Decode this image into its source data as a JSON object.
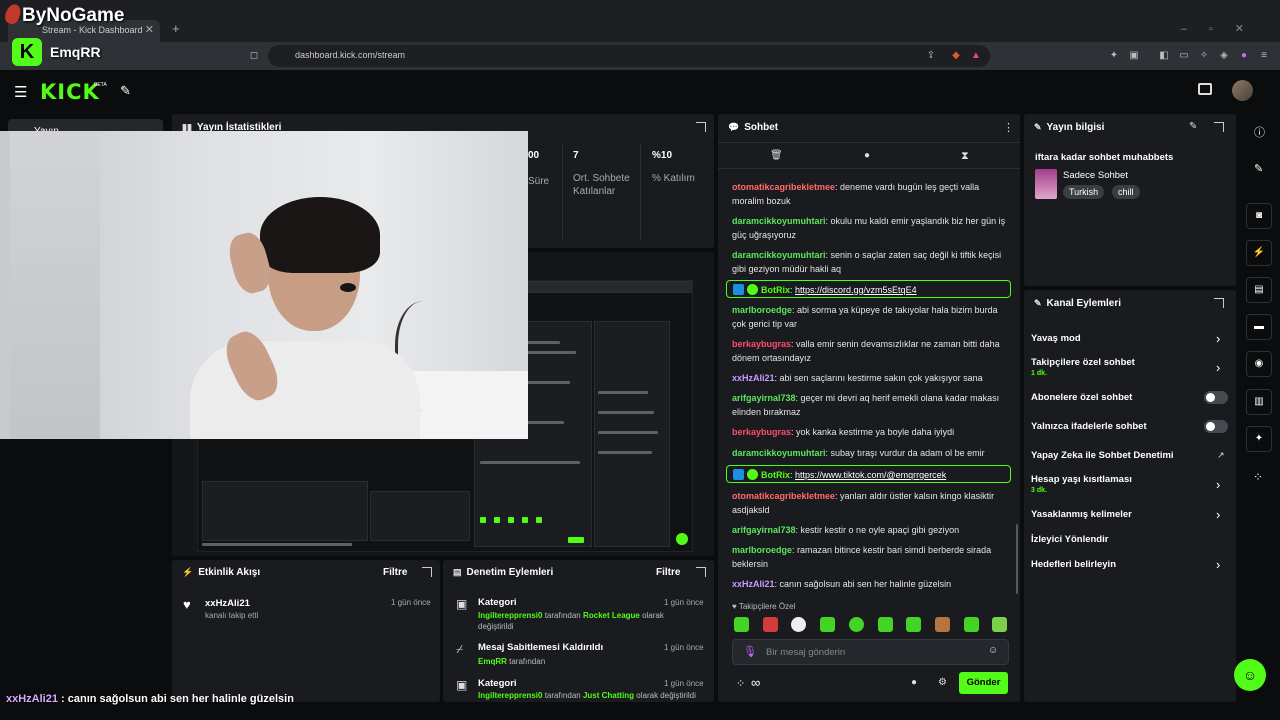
{
  "browser": {
    "tab_title": "Stream - Kick Dashboard",
    "url": "dashboard.kick.com/stream"
  },
  "overlay": {
    "brand": "ByNoGame",
    "streamer_name": "EmqRR",
    "ticker_user": "xxHzAli21",
    "ticker_message": " : canın sağolsun abi sen her halinle güzelsin"
  },
  "header": {
    "logo": "KICK",
    "beta": "BETA"
  },
  "sidebar": {
    "item_label": "Yayın"
  },
  "stats": {
    "title": "Yayın İstatistikleri",
    "columns": [
      {
        "value": "00",
        "label": "Süre"
      },
      {
        "value": "7",
        "label": "Ort. Sohbete Katılanlar"
      },
      {
        "value": "%10",
        "label": "% Katılım"
      }
    ]
  },
  "activity": {
    "title": "Etkinlik Akışı",
    "filter": "Filtre",
    "items": [
      {
        "user": "xxHzAli21",
        "desc": "kanalı takip etti",
        "time": "1 gün önce"
      }
    ]
  },
  "moderation": {
    "title": "Denetim Eylemleri",
    "filter": "Filtre",
    "items": [
      {
        "title": "Kategori",
        "actor": "Ingilterepprensi0",
        "mid": " tarafından ",
        "target": "Rocket League",
        "tail": " olarak değiştirildi",
        "time": "1 gün önce"
      },
      {
        "title": "Mesaj Sabitlemesi Kaldırıldı",
        "actor": "EmqRR",
        "mid": " tarafından",
        "target": "",
        "tail": "",
        "time": "1 gün önce"
      },
      {
        "title": "Kategori",
        "actor": "Ingilterepprensi0",
        "mid": " tarafından ",
        "target": "Just Chatting",
        "tail": " olarak değiştirildi",
        "time": "1 gün önce"
      }
    ]
  },
  "chat": {
    "title": "Sohbet",
    "messages": [
      {
        "user": "otomatikcagribekletmee",
        "color": "#ff6b6b",
        "text": ": deneme vardı bugün leş geçti valla moralim bozuk"
      },
      {
        "user": "daramcikkoyumuhtari",
        "color": "#5ce65c",
        "text": ": okulu mu kaldı emir yaşlandık biz her gün iş güç uğraşıyoruz"
      },
      {
        "user": "daramcikkoyumuhtari",
        "color": "#5ce65c",
        "text": ": senin o saçlar zaten saç değil ki tiftik keçisi gibi geziyon müdür hakli aq"
      },
      {
        "user": "marlboroedge",
        "color": "#5ce65c",
        "text": ": abi sorma ya küpeye de takıyolar hala bizim burda çok gerici tip var"
      },
      {
        "user": "berkaybugras",
        "color": "#ff4d6d",
        "text": ": valla emir senin devamsızlıklar ne zaman bitti daha dönem ortasındayız"
      },
      {
        "user": "xxHzAli21",
        "color": "#c89bff",
        "text": ": abi sen saçlarını kestirme sakın çok yakışıyor sana"
      },
      {
        "user": "arifgayirnal738",
        "color": "#5ce65c",
        "text": ": geçer mi devri aq herif emekli olana kadar makası elinden bırakmaz"
      },
      {
        "user": "berkaybugras",
        "color": "#ff4d6d",
        "text": ": yok kanka kestirme ya boyle daha iyiydi"
      },
      {
        "user": "daramcikkoyumuhtari",
        "color": "#5ce65c",
        "text": ": subay tıraşı vurdur da adam ol be emir"
      },
      {
        "user": "otomatikcagribekletmee",
        "color": "#ff6b6b",
        "text": ": yanları aldır üstler kalsın kingo klasiktir asdjaksld"
      },
      {
        "user": "arifgayirnal738",
        "color": "#5ce65c",
        "text": ": kestir kestir o ne oyle apaçi gibi geziyon"
      },
      {
        "user": "marlboroedge",
        "color": "#5ce65c",
        "text": ": ramazan bitince kestir bari simdi berberde sirada beklersin"
      },
      {
        "user": "xxHzAli21",
        "color": "#c89bff",
        "text": ": canın sağolsun abi sen her halinle güzelsin"
      }
    ],
    "bot_messages": [
      {
        "name": "BotRix",
        "link": "https://discord.gg/vzm5sEtqE4"
      },
      {
        "name": "BotRix",
        "link": "https://www.tiktok.com/@emqrrgercek"
      }
    ],
    "followers_only": "Takipçilere Özel",
    "input_placeholder": "Bir mesaj gönderin",
    "send_label": "Gönder",
    "infinity": "∞"
  },
  "stream_info": {
    "title": "Yayın bilgisi",
    "stream_title": "iftara kadar sohbet muhabbets",
    "category": "Sadece Sohbet",
    "tags": [
      "Turkish",
      "chill"
    ]
  },
  "channel_actions": {
    "title": "Kanal Eylemleri",
    "items": [
      {
        "label": "Yavaş mod",
        "sub": "",
        "control": "chevron"
      },
      {
        "label": "Takipçilere özel sohbet",
        "sub": "1 dk.",
        "control": "chevron"
      },
      {
        "label": "Abonelere özel sohbet",
        "sub": "",
        "control": "toggle"
      },
      {
        "label": "Yalnızca ifadelerle sohbet",
        "sub": "",
        "control": "toggle"
      },
      {
        "label": "Yapay Zeka ile Sohbet Denetimi",
        "sub": "",
        "control": "external"
      },
      {
        "label": "Hesap yaşı kısıtlaması",
        "sub": "3 dk.",
        "control": "chevron"
      },
      {
        "label": "Yasaklanmış kelimeler",
        "sub": "",
        "control": "chevron"
      },
      {
        "label": "İzleyici Yönlendir",
        "sub": "",
        "control": "none"
      },
      {
        "label": "Hedefleri belirleyin",
        "sub": "",
        "control": "chevron"
      }
    ]
  },
  "colors": {
    "brand": "#53fc18",
    "panel": "#191b1f",
    "bg": "#0b0c0d"
  }
}
